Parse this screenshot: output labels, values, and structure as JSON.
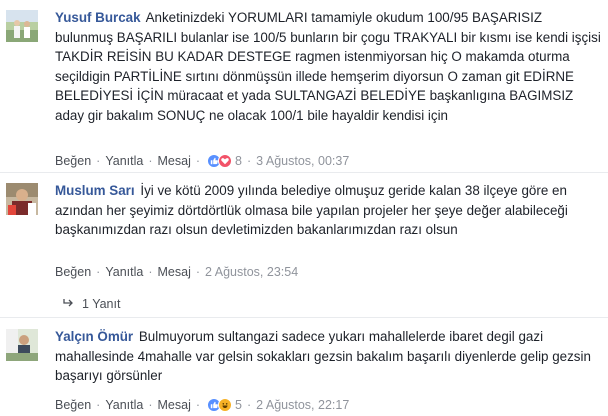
{
  "comments": [
    {
      "author": "Yusuf Burcak",
      "text": "Anketinizdeki YORUMLARI tamamiyle okudum 100/95 BAŞARISIZ bulunmuş BAŞARILI bulanlar ise 100/5 bunların bir çogu TRAKYALI bir kısmı ise kendi işçisi TAKDİR REİSİN BU KADAR DESTEGE ragmen istenmiyorsan hiç O makamda oturma seçildigin PARTİLİNE sırtını dönmüşsün illede hemşerim diyorsun O zaman git EDİRNE BELEDİYESİ İÇİN müracaat et yada SULTANGAZİ BELEDİYE başkanlıgına BAGIMSIZ aday gir bakalım SONUÇ ne olacak 100/1 bile hayaldir kendisi için",
      "like_label": "Beğen",
      "reply_label": "Yanıtla",
      "message_label": "Mesaj",
      "reaction_count": "8",
      "reactions": [
        "like-icon",
        "love-icon"
      ],
      "time": "3 Ağustos, 00:37"
    },
    {
      "author": "Muslum Sarı",
      "text": "İyi ve kötü 2009 yılında belediye olmuşuz geride kalan 38 ilçeye göre en azından her şeyimiz dörtdörtlük olmasa bile yapılan projeler her şeye değer alabileceği başkanımızdan razı olsun devletimizden bakanlarımızdan razı olsun",
      "like_label": "Beğen",
      "reply_label": "Yanıtla",
      "message_label": "Mesaj",
      "time": "2 Ağustos, 23:54",
      "replies_label": "1 Yanıt"
    },
    {
      "author": "Yalçın Ömür",
      "text": "Bulmuyorum sultangazi sadece yukarı mahallelerde ibaret degil gazi mahallesinde 4mahalle var gelsin sokakları gezsin bakalım başarılı diyenlerde gelip gezsin başarıyı görsünler",
      "like_label": "Beğen",
      "reply_label": "Yanıtla",
      "message_label": "Mesaj",
      "reaction_count": "5",
      "reactions": [
        "like-icon",
        "haha-icon"
      ],
      "time": "2 Ağustos, 22:17"
    }
  ],
  "colors": {
    "author": "#365899",
    "text": "#1d2129",
    "meta": "#90949c",
    "like": "#5890ff",
    "love": "#f25268",
    "haha": "#f7b125"
  }
}
